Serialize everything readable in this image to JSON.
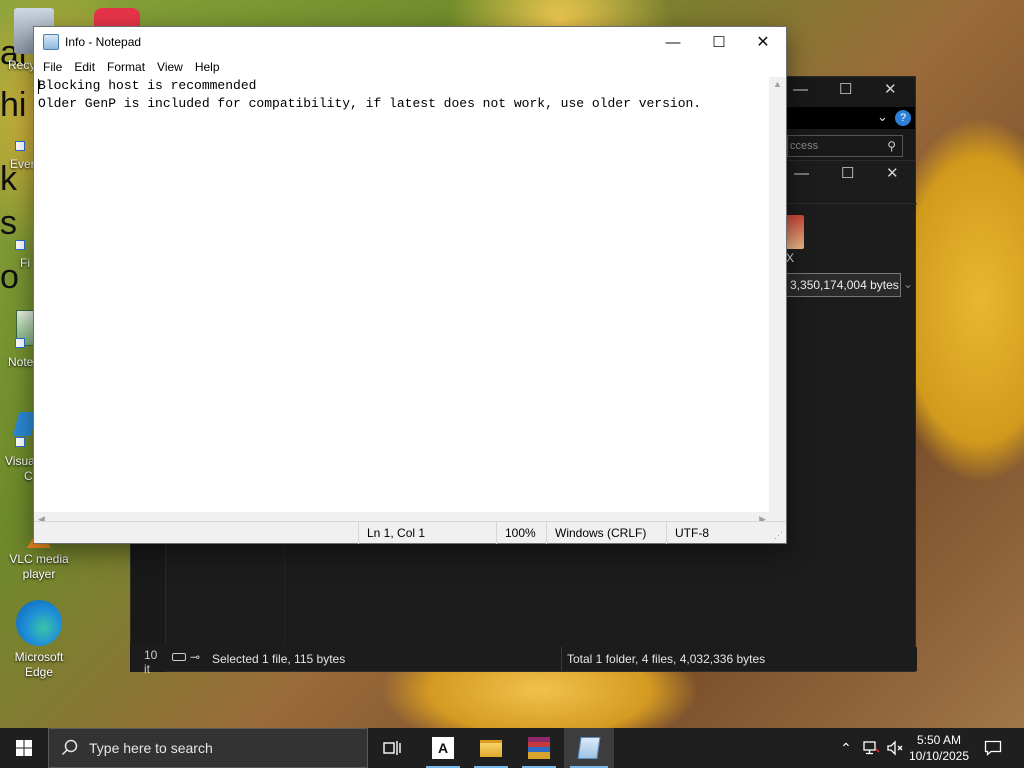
{
  "desktop": {
    "icons": [
      {
        "label": "Recy"
      },
      {
        "label": "Ever"
      },
      {
        "label": "Fi"
      },
      {
        "label": "Note"
      },
      {
        "label": "Visua",
        "label2": "C"
      },
      {
        "label": "VLC media",
        "label2": "player"
      },
      {
        "label": "Microsoft",
        "label2": "Edge"
      }
    ]
  },
  "explorer_back": {
    "search_placeholder": "ccess",
    "file_tile_label": "X",
    "tooltip_size": "e 3,350,174,004 bytes",
    "items_count": "10 it",
    "status_selected": "Selected 1 file, 115 bytes",
    "status_total": "Total 1 folder, 4 files, 4,032,336 bytes"
  },
  "notepad": {
    "title": "Info - Notepad",
    "menu": [
      "File",
      "Edit",
      "Format",
      "View",
      "Help"
    ],
    "lines": [
      "Blocking host is recommended",
      "Older GenP is included for compatibility, if latest does not work, use older version."
    ],
    "status": {
      "position": "Ln 1, Col 1",
      "zoom": "100%",
      "line_ending": "Windows (CRLF)",
      "encoding": "UTF-8"
    }
  },
  "taskbar": {
    "search_placeholder": "Type here to search",
    "time": "5:50 AM",
    "date": "10/10/2025"
  },
  "colors": {
    "accent": "#76b9ed",
    "taskbar": "#1f1f1f",
    "dark_window": "#191919"
  }
}
